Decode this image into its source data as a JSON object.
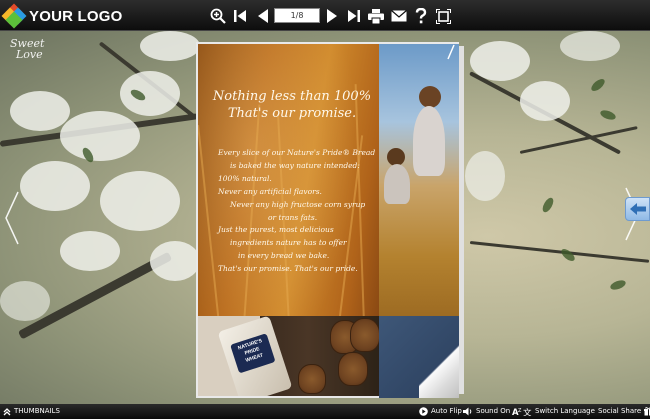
{
  "header": {
    "logo_text": "YOUR LOGO",
    "page_indicator": "1/8"
  },
  "toolbar": {
    "icons": [
      "zoom-in-icon",
      "first-page-icon",
      "previous-page-icon",
      "next-page-icon",
      "last-page-icon",
      "print-icon",
      "email-icon",
      "help-icon",
      "fullscreen-icon"
    ]
  },
  "watermark": {
    "line1": "Sweet",
    "line2": "Love"
  },
  "ad": {
    "headline_1": "Nothing less than 100%",
    "headline_2": "That's our promise.",
    "body": [
      "Every slice of our Nature's Pride® Bread",
      "is baked the way nature intended:",
      "100% natural.",
      "Never any artificial flavors.",
      "Never any high fructose corn syrup",
      "or trans fats.",
      "Just the purest, most delicious",
      "ingredients nature has to offer",
      "in every bread we bake.",
      "That's our promise. That's our pride."
    ],
    "bag_label_1": "NATURE'S",
    "bag_label_2": "PRIDE",
    "bag_label_3": "WHEAT"
  },
  "footer": {
    "thumbnails": "THUMBNAILS",
    "auto_flip": "Auto Flip",
    "sound": "Sound On",
    "language": "Switch Language",
    "social": "Social Share"
  },
  "colors": {
    "toolbar_bg": "#111111",
    "accent_tab": "#8fb9e6",
    "wheat": "#c07a22"
  }
}
